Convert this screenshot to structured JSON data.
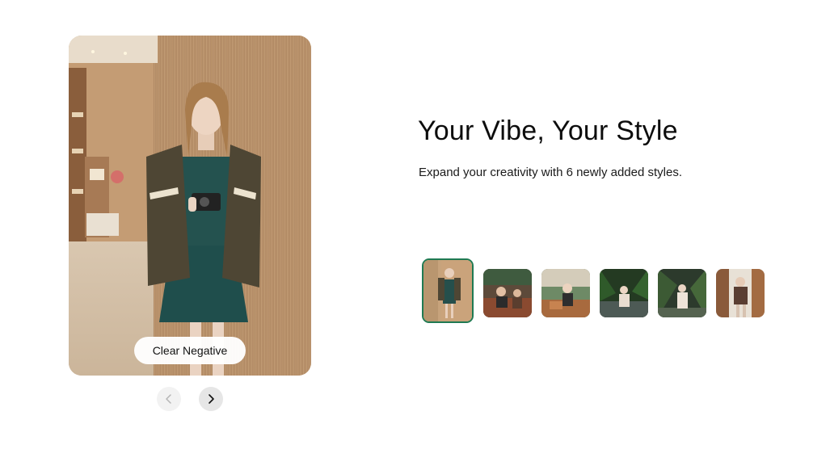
{
  "preview": {
    "style_label": "Clear Negative"
  },
  "navigation": {
    "prev_icon": "chevron-left-icon",
    "next_icon": "chevron-right-icon"
  },
  "headline": {
    "title": "Your Vibe, Your Style",
    "subtitle": "Expand your creativity with 6 newly added styles."
  },
  "thumbnails": {
    "selected_index": 0,
    "accent_color": "#1f7a52",
    "items": [
      {
        "name": "thumb-clear-negative"
      },
      {
        "name": "thumb-style-2"
      },
      {
        "name": "thumb-style-3"
      },
      {
        "name": "thumb-style-4"
      },
      {
        "name": "thumb-style-5"
      },
      {
        "name": "thumb-style-6"
      }
    ]
  }
}
